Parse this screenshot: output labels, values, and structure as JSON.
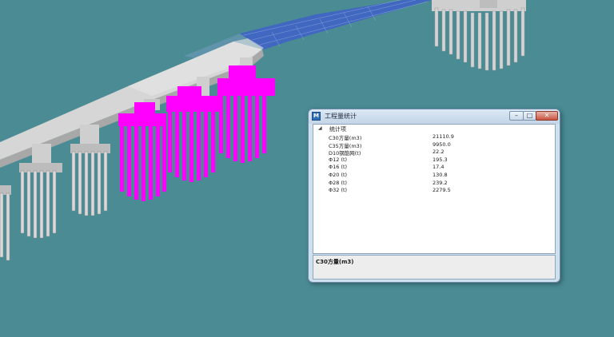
{
  "colors": {
    "background": "#4a8b94",
    "highlight_piers": "#ff00ff",
    "concrete": "#d6d6d6",
    "deck_mesh": "#3f62c9"
  },
  "dialog": {
    "title": "工程量统计",
    "app_icon": "app-logo-icon",
    "controls": {
      "minimize": "–",
      "maximize": "□",
      "close": "✕"
    },
    "tree": {
      "root_label": "统计项",
      "expand_icon": "triangle-down-icon",
      "rows": [
        {
          "name": "C30方量(m3)",
          "value": "21110.9"
        },
        {
          "name": "C35方量(m3)",
          "value": "9950.0"
        },
        {
          "name": "D10钢筋网(t)",
          "value": "22.2"
        },
        {
          "name": "Φ12 (t)",
          "value": "195.3"
        },
        {
          "name": "Φ16 (t)",
          "value": "17.4"
        },
        {
          "name": "Φ20 (t)",
          "value": "130.8"
        },
        {
          "name": "Φ28 (t)",
          "value": "239.2"
        },
        {
          "name": "Φ32 (t)",
          "value": "2279.5"
        }
      ]
    },
    "selected_item": "C30方量(m3)"
  }
}
